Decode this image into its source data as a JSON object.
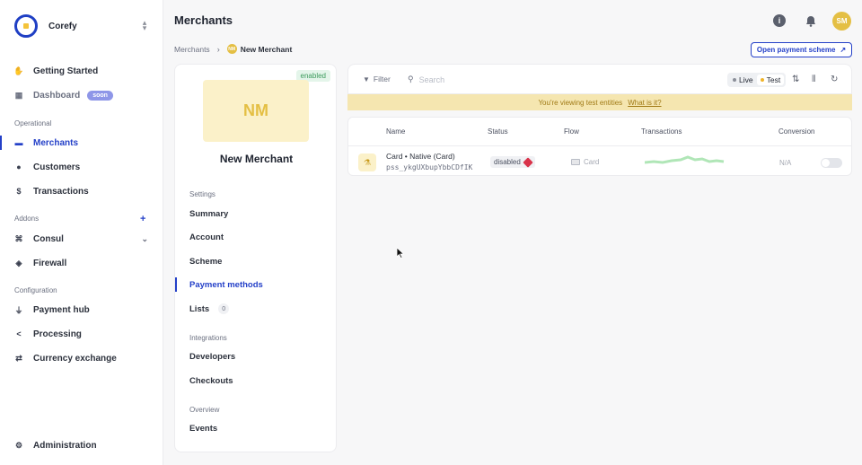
{
  "brand": {
    "name": "Corefy",
    "switch_icon": "chevron-updown-icon"
  },
  "sidebar": {
    "top_items": [
      {
        "label": "Getting Started",
        "icon": "waving-hand-icon"
      },
      {
        "label": "Dashboard",
        "icon": "dashboard-icon",
        "badge": "soon"
      }
    ],
    "sections": {
      "operational": "Operational",
      "addons": "Addons",
      "configuration": "Configuration"
    },
    "operational_items": [
      {
        "label": "Merchants",
        "icon": "store-icon",
        "active": true
      },
      {
        "label": "Customers",
        "icon": "users-icon"
      },
      {
        "label": "Transactions",
        "icon": "dollar-icon"
      }
    ],
    "addons_items": [
      {
        "label": "Consul",
        "icon": "command-icon"
      },
      {
        "label": "Firewall",
        "icon": "shield-icon"
      }
    ],
    "configuration_items": [
      {
        "label": "Payment hub",
        "icon": "plug-icon"
      },
      {
        "label": "Processing",
        "icon": "share-icon"
      },
      {
        "label": "Currency exchange",
        "icon": "exchange-icon"
      }
    ],
    "bottom_item": {
      "label": "Administration",
      "icon": "gear-icon"
    }
  },
  "header": {
    "title": "Merchants",
    "avatar_initials": "SM",
    "breadcrumb": {
      "root": "Merchants",
      "badge": "NM",
      "current": "New Merchant"
    },
    "scheme_button": "Open payment scheme"
  },
  "merchant": {
    "status": "enabled",
    "initials": "NM",
    "name": "New Merchant",
    "groups": {
      "settings": "Settings",
      "integrations": "Integrations",
      "overview": "Overview"
    },
    "settings_items": [
      "Summary",
      "Account",
      "Scheme",
      "Payment methods",
      "Lists"
    ],
    "lists_count": "0",
    "integrations_items": [
      "Developers",
      "Checkouts"
    ],
    "overview_items": [
      "Events"
    ]
  },
  "toolbar": {
    "filter": "Filter",
    "search_placeholder": "Search",
    "live": "Live",
    "test": "Test",
    "colors": {
      "live_dot": "#8b8f99",
      "test_dot": "#f0b429"
    }
  },
  "notice": {
    "text": "You're viewing test entities",
    "link": "What is it?"
  },
  "table": {
    "headers": [
      "Name",
      "Status",
      "Flow",
      "Transactions",
      "Conversion"
    ],
    "rows": [
      {
        "name": "Card • Native (Card)",
        "id": "pss_ykgUXbupYbbCDfIK",
        "status": "disabled",
        "flow": "Card",
        "conversion": "N/A"
      }
    ]
  },
  "colors": {
    "accent": "#2440c8",
    "brand_yellow": "#e4bf44",
    "notice_bg": "#f5e6b0"
  }
}
